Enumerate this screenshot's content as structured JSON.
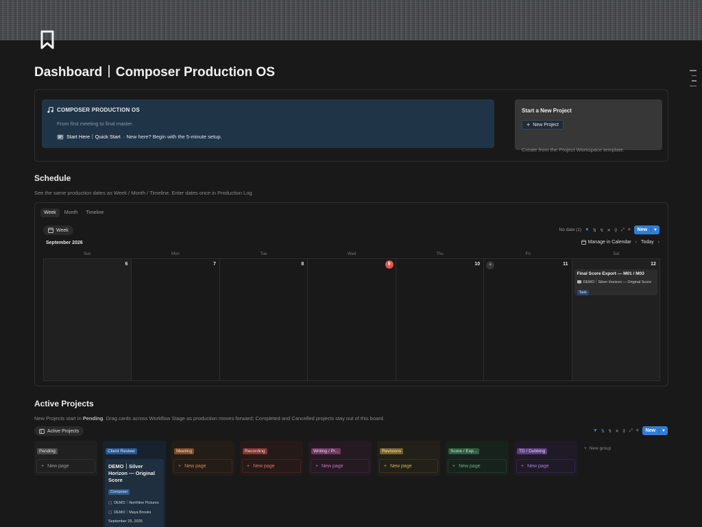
{
  "page": {
    "title_left": "Dashboard",
    "title_right": "Composer Production OS",
    "icon": "bookmark-icon"
  },
  "hero": {
    "banner_title": "COMPOSER PRODUCTION OS",
    "banner_subtitle": "From first meeting to final master.",
    "quickstart_link": "Start Here｜Quick Start",
    "quickstart_text": " · New here? Begin with the 5-minute setup.",
    "newproj_title": "Start a New Project",
    "newproj_button": "New Project",
    "newproj_text": "Create from the Project Workspace template."
  },
  "schedule": {
    "heading": "Schedule",
    "description": "See the same production dates as Week / Month / Timeline. Enter dates once in Production Log.",
    "tabs": [
      "Week",
      "Month",
      "Timeline"
    ],
    "view_button": "Week",
    "no_date": "No date (1)",
    "new_button": "New",
    "month_label": "September 2026",
    "manage_calendar": "Manage in Calendar",
    "today_button": "Today",
    "days": [
      "Sun",
      "Mon",
      "Tue",
      "Wed",
      "Thu",
      "Fri",
      "Sat"
    ],
    "dates": [
      "6",
      "7",
      "8",
      "9",
      "10",
      "11",
      "12"
    ],
    "event": {
      "title": "Final Score Export — M01 / M03",
      "project": "DEMO｜Silver Horizon — Original Score",
      "tag": "Task"
    }
  },
  "projects": {
    "heading": "Active Projects",
    "description_pre": "New Projects start in ",
    "description_bold": "Pending",
    "description_post": ". Drag cards across Workflow Stage as production moves forward; Completed and Cancelled projects stay out of this board.",
    "view_button": "Active Projects",
    "new_button": "New",
    "new_page": "New page",
    "new_group": "New group",
    "columns": [
      {
        "name": "Pending",
        "bg": "#202020",
        "tag_bg": "#4a4a4a",
        "tag_fg": "#e0e0e0",
        "np_fg": "#9a9a9a",
        "np_bd": "#303030"
      },
      {
        "name": "Client Review",
        "bg": "#17222e",
        "tag_bg": "#28558a",
        "tag_fg": "#e3efff",
        "np_fg": "#6fa3dd",
        "np_bd": "#24364a"
      },
      {
        "name": "Meeting",
        "bg": "#241c17",
        "tag_bg": "#7a4b2a",
        "tag_fg": "#f4dcc8",
        "np_fg": "#d08a55",
        "np_bd": "#3a2b20"
      },
      {
        "name": "Recording",
        "bg": "#261a19",
        "tag_bg": "#7d3633",
        "tag_fg": "#f5d6d4",
        "np_fg": "#d7736b",
        "np_bd": "#3c2624"
      },
      {
        "name": "Writing / Pr...",
        "bg": "#251a22",
        "tag_bg": "#6d3860",
        "tag_fg": "#f2d6eb",
        "np_fg": "#c873b3",
        "np_bd": "#3a2636"
      },
      {
        "name": "Revisions",
        "bg": "#23201a",
        "tag_bg": "#73612a",
        "tag_fg": "#f5ecc8",
        "np_fg": "#cfaf55",
        "np_bd": "#37311f"
      },
      {
        "name": "Score / Exp...",
        "bg": "#18221c",
        "tag_bg": "#2e5b3e",
        "tag_fg": "#d3f0dc",
        "np_fg": "#65b17c",
        "np_bd": "#243629"
      },
      {
        "name": "TD / Dubbing",
        "bg": "#201a26",
        "tag_bg": "#5a3d7a",
        "tag_fg": "#e6d8f6",
        "np_fg": "#a77fd2",
        "np_bd": "#322640"
      }
    ],
    "card": {
      "title": "DEMO｜Silver Horizon — Original Score",
      "role": "Composer",
      "client": "DEMO｜Northline Pictures",
      "contact": "DEMO｜Maya Brooks",
      "date": "September 25, 2026"
    }
  }
}
